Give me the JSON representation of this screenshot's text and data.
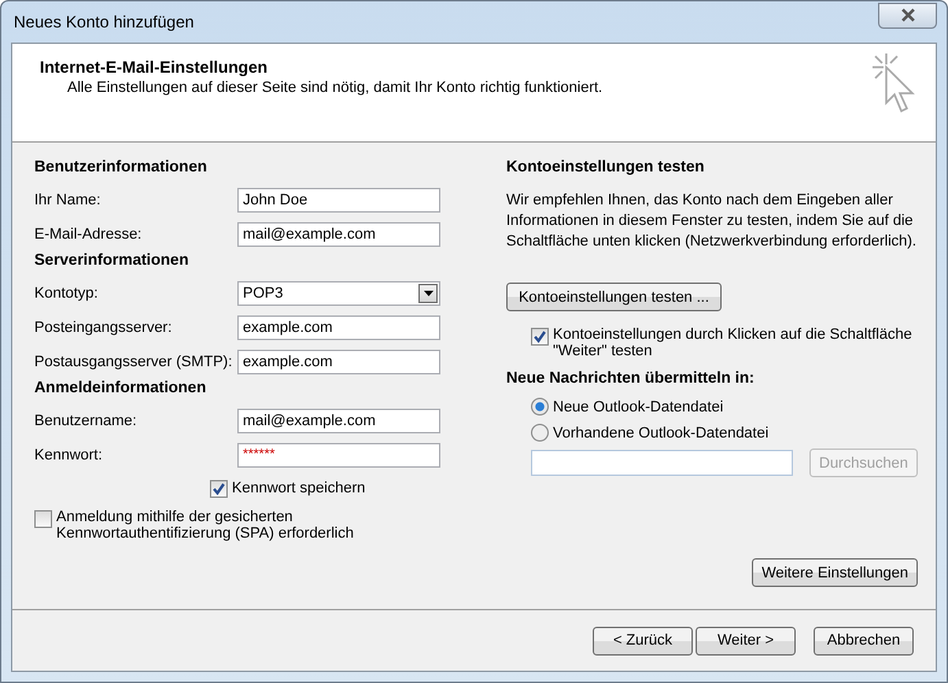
{
  "window": {
    "title": "Neues Konto hinzufügen"
  },
  "header": {
    "title": "Internet-E-Mail-Einstellungen",
    "subtitle": "Alle Einstellungen auf dieser Seite sind nötig, damit Ihr Konto richtig funktioniert."
  },
  "left": [
    {
      "kind": "heading",
      "text": "Benutzerinformationen"
    },
    {
      "kind": "text",
      "label": "Ihr Name:",
      "value": "John Doe"
    },
    {
      "kind": "text",
      "label": "E-Mail-Adresse:",
      "value": "mail@example.com"
    },
    {
      "kind": "heading",
      "text": "Serverinformationen"
    },
    {
      "kind": "select",
      "label": "Kontotyp:",
      "value": "POP3"
    },
    {
      "kind": "text",
      "label": "Posteingangsserver:",
      "value": "example.com"
    },
    {
      "kind": "text",
      "label": "Postausgangsserver (SMTP):",
      "value": "example.com"
    },
    {
      "kind": "heading",
      "text": "Anmeldeinformationen"
    },
    {
      "kind": "text",
      "label": "Benutzername:",
      "value": "mail@example.com"
    },
    {
      "kind": "password",
      "label": "Kennwort:",
      "value": "******"
    },
    {
      "kind": "checkbox",
      "label": "Kennwort speichern",
      "checked": true
    },
    {
      "kind": "checkbox-wide",
      "label": "Anmeldung mithilfe der gesicherten Kennwortauthentifizierung (SPA) erforderlich",
      "checked": false
    }
  ],
  "right": {
    "title": "Kontoeinstellungen testen",
    "description": "Wir empfehlen Ihnen, das Konto nach dem Eingeben aller Informationen in diesem Fenster zu testen, indem Sie auf die Schaltfläche unten klicken (Netzwerkverbindung erforderlich).",
    "test_button": "Kontoeinstellungen testen ...",
    "test_on_next": {
      "label": "Kontoeinstellungen durch Klicken auf die Schaltfläche \"Weiter\" testen",
      "checked": true
    },
    "deliver_title": "Neue Nachrichten übermitteln in:",
    "deliver_options": [
      {
        "label": "Neue Outlook-Datendatei",
        "selected": true
      },
      {
        "label": "Vorhandene Outlook-Datendatei",
        "selected": false
      }
    ],
    "browse_button": {
      "label": "Durchsuchen",
      "disabled": true
    },
    "more_button": "Weitere Einstellungen"
  },
  "buttons": [
    {
      "label": "< Zurück",
      "disabled": false
    },
    {
      "label": "Weiter >",
      "disabled": false
    },
    {
      "label": "Abbrechen",
      "disabled": false
    }
  ]
}
